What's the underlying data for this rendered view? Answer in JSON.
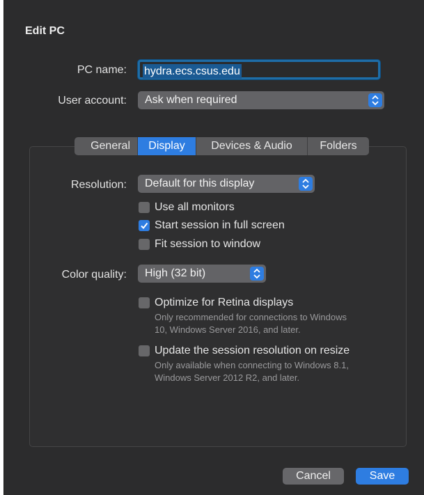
{
  "dialog": {
    "title": "Edit PC"
  },
  "pc_name": {
    "label": "PC name:",
    "value": "hydra.ecs.csus.edu"
  },
  "user_account": {
    "label": "User account:",
    "value": "Ask when required"
  },
  "tabs": [
    {
      "label": "General",
      "active": false
    },
    {
      "label": "Display",
      "active": true
    },
    {
      "label": "Devices & Audio",
      "active": false
    },
    {
      "label": "Folders",
      "active": false
    }
  ],
  "display": {
    "resolution": {
      "label": "Resolution:",
      "value": "Default for this display"
    },
    "use_all_monitors": {
      "label": "Use all monitors",
      "checked": false
    },
    "full_screen": {
      "label": "Start session in full screen",
      "checked": true
    },
    "fit_to_window": {
      "label": "Fit session to window",
      "checked": false
    },
    "color_quality": {
      "label": "Color quality:",
      "value": "High (32 bit)"
    },
    "retina": {
      "label": "Optimize for Retina displays",
      "checked": false,
      "hint_line1": "Only recommended for connections to Windows",
      "hint_line2": "10, Windows Server 2016, and later."
    },
    "resize": {
      "label": "Update the session resolution on resize",
      "checked": false,
      "hint_line1": "Only available when connecting to Windows 8.1,",
      "hint_line2": "Windows Server 2012 R2, and later."
    }
  },
  "buttons": {
    "cancel": "Cancel",
    "save": "Save"
  },
  "colors": {
    "accent": "#2e7de1",
    "background": "#2c2c2d"
  }
}
